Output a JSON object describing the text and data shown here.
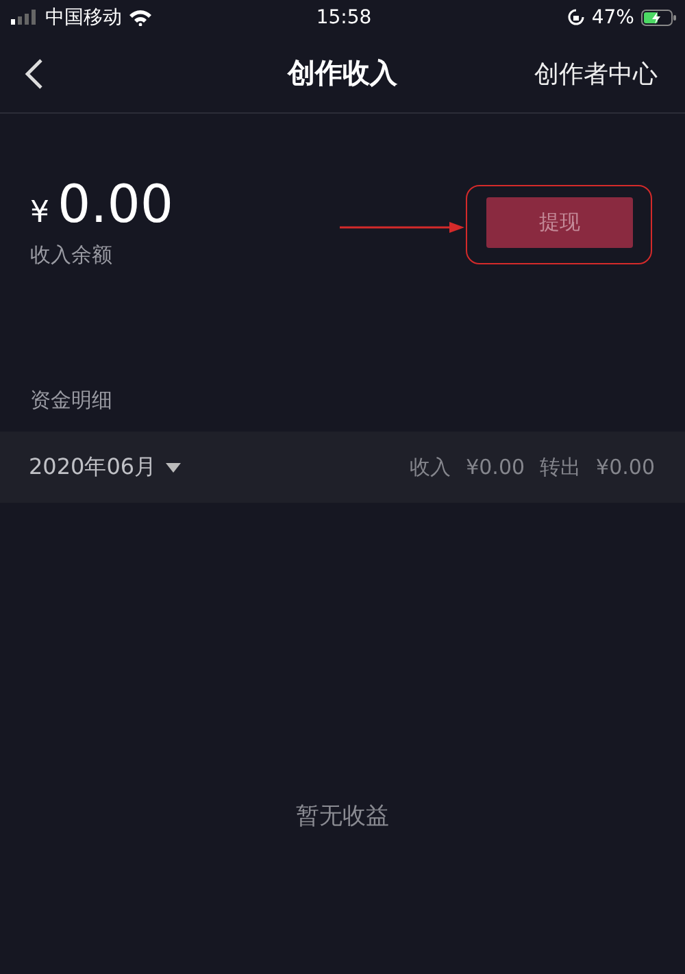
{
  "status_bar": {
    "carrier": "中国移动",
    "time": "15:58",
    "battery_percent": "47%"
  },
  "nav": {
    "title": "创作收入",
    "action": "创作者中心"
  },
  "balance": {
    "amount": "0.00",
    "currency": "¥",
    "label": "收入余额",
    "withdraw_button": {
      "label": "提现",
      "disabled": true
    }
  },
  "section_title": "资金明细",
  "filter": {
    "month": "2020年06月",
    "income_label": "收入",
    "income": "¥0.00",
    "out_label": "转出",
    "out": "¥0.00"
  },
  "empty_text": "暂无收益"
}
